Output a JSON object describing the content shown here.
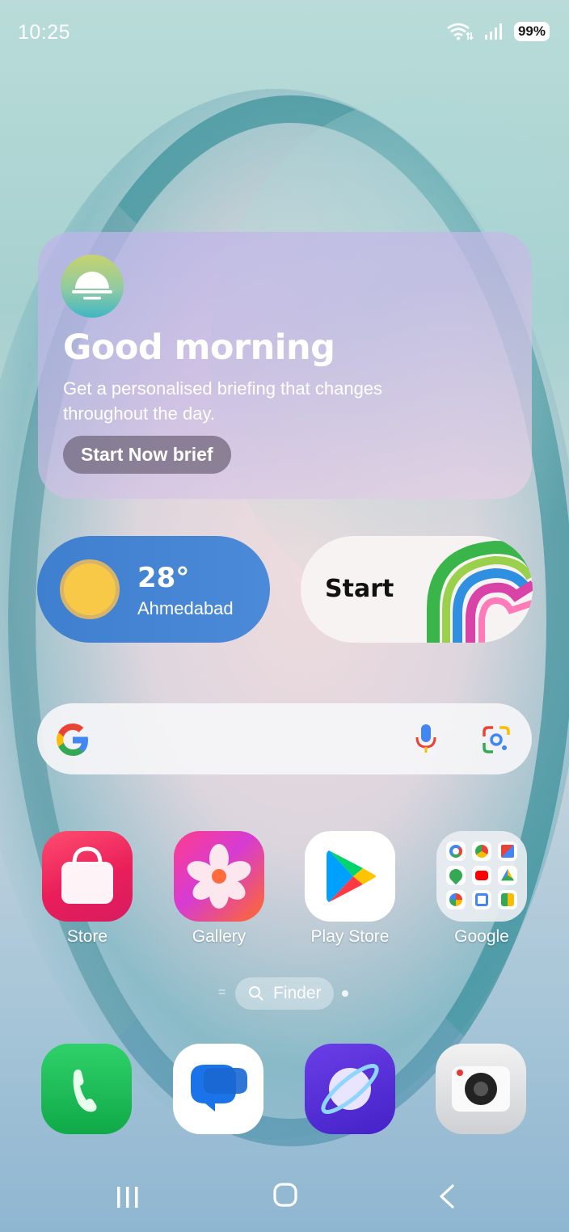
{
  "status_bar": {
    "time": "10:25",
    "battery": "99%",
    "icons": [
      "wifi-icon",
      "signal-icon",
      "battery-icon"
    ]
  },
  "briefing_widget": {
    "title": "Good morning",
    "description": "Get a personalised briefing that changes throughout the day.",
    "button_label": "Start Now brief",
    "icon": "sunrise-icon"
  },
  "weather_widget": {
    "temperature": "28°",
    "city": "Ahmedabad",
    "icon": "sun-icon"
  },
  "start_widget": {
    "label": "Start",
    "icon": "start-rainbow-logo"
  },
  "search_bar": {
    "icons": [
      "google-g-icon",
      "mic-icon",
      "google-lens-icon"
    ]
  },
  "apps": [
    {
      "label": "Store",
      "icon": "store-bag-icon"
    },
    {
      "label": "Gallery",
      "icon": "gallery-flower-icon"
    },
    {
      "label": "Play Store",
      "icon": "play-store-icon"
    },
    {
      "label": "Google",
      "icon": "google-folder-icon"
    }
  ],
  "finder": {
    "label": "Finder",
    "icon": "search-icon"
  },
  "dock": [
    {
      "name": "Phone",
      "icon": "phone-icon"
    },
    {
      "name": "Messages",
      "icon": "messages-icon"
    },
    {
      "name": "Internet",
      "icon": "internet-planet-icon"
    },
    {
      "name": "Camera",
      "icon": "camera-icon"
    }
  ],
  "navigation": [
    "recents-button",
    "home-button",
    "back-button"
  ],
  "colors": {
    "weather_widget": "#4583d4",
    "sun": "#f8c847",
    "phone": "#1fbf59",
    "internet": "#5530d8",
    "store": "#e91e5a"
  }
}
